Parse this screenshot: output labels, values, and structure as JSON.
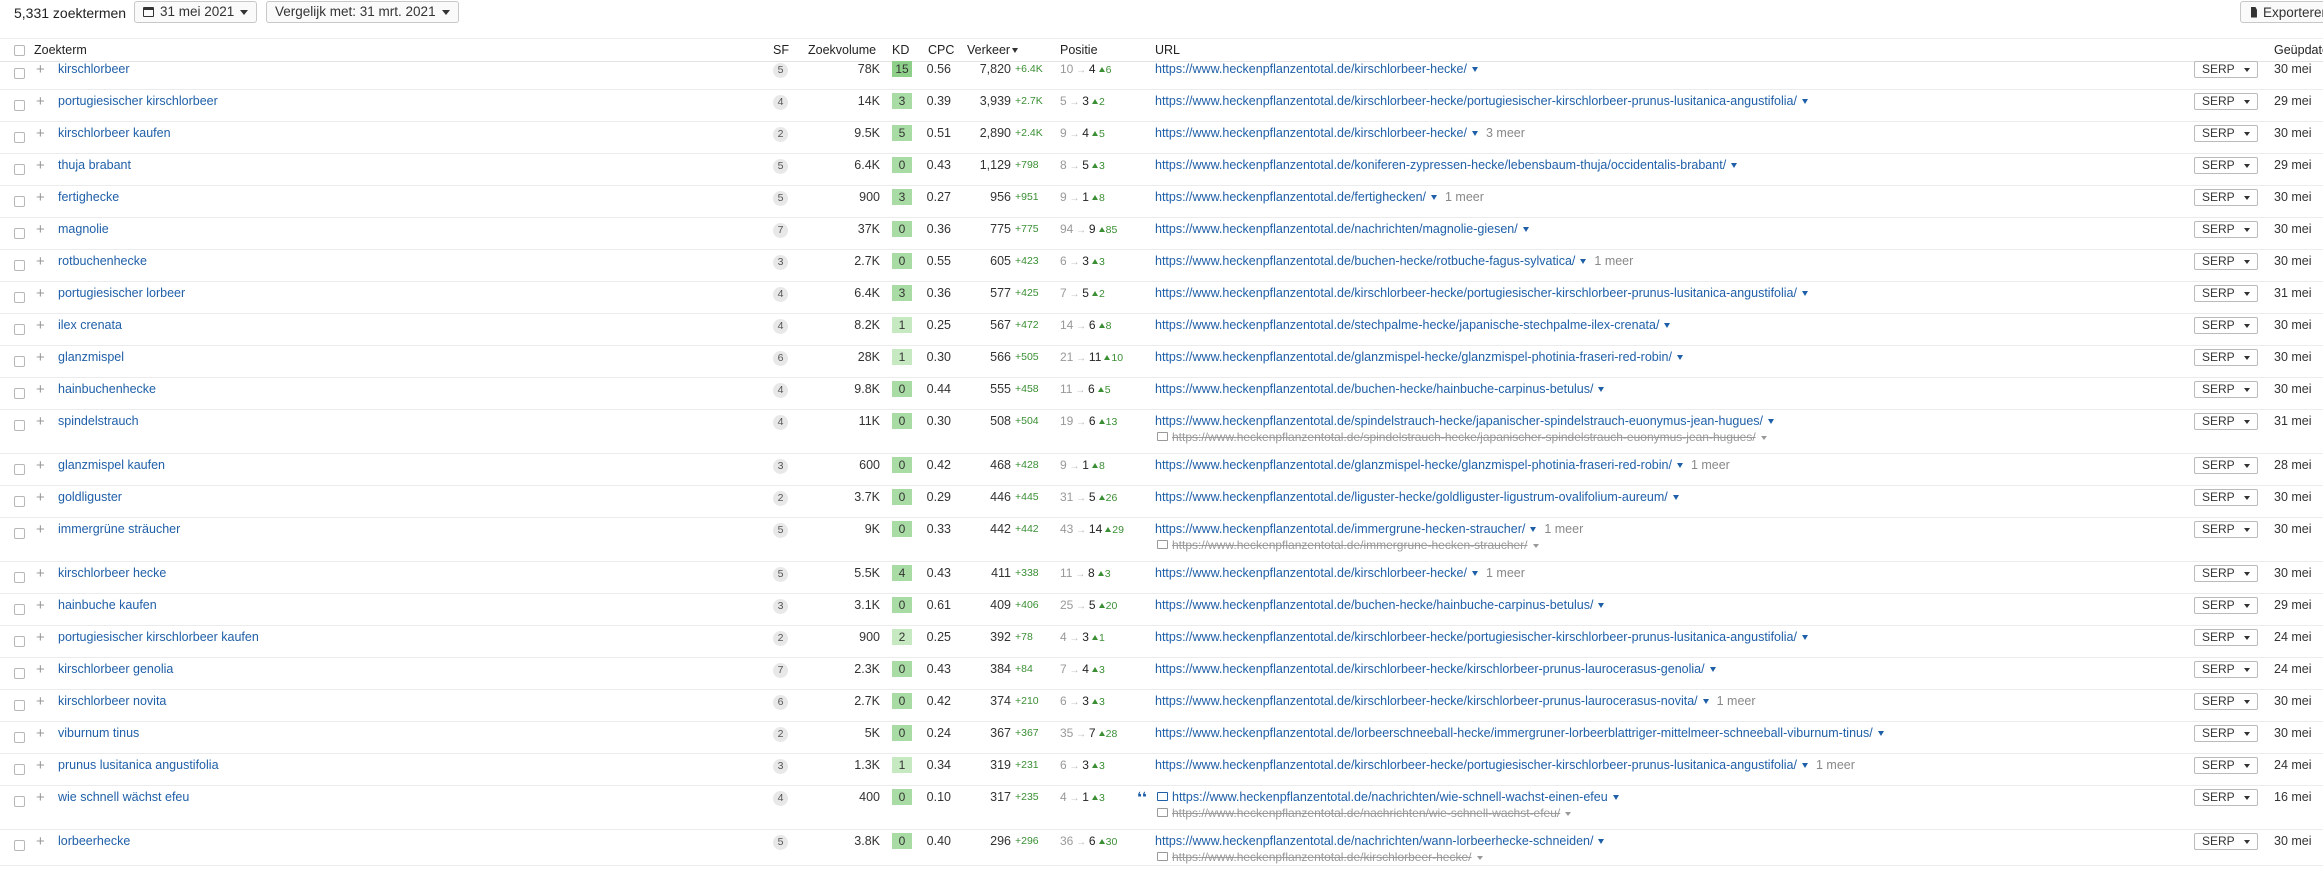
{
  "toolbar": {
    "count": "5,331 zoekterm­en",
    "date": "31 mei 2021",
    "compare": "Vergelijk met: 31 mrt. 2021",
    "export": "Exporteren"
  },
  "columns": {
    "keyword": "Zoekterm",
    "sf": "SF",
    "volume": "Zoekvolume",
    "kd": "KD",
    "cpc": "CPC",
    "traffic": "Verkeer",
    "position": "Positie",
    "url": "URL",
    "updated": "Geüpdatet"
  },
  "colors": {
    "link": "#1f5fa8",
    "positive": "#3a8f34",
    "kd_high": "#8ed08a",
    "kd_mid": "#a9dca5",
    "kd_low": "#c6e9c2"
  },
  "serp_label": "SERP",
  "rows": [
    {
      "kw": "kirschlorbeer",
      "sf": "5",
      "vol": "78K",
      "kd": "15",
      "cpc": "0.56",
      "traffic": "7,820",
      "tchg": "+6.4K",
      "from": "10",
      "to": "4",
      "delta": "6",
      "url": "https://www.heckenpflanzentotal.de/kirschlorbeer-hecke/",
      "more": "",
      "url2": "",
      "upd": "30 mei"
    },
    {
      "kw": "portugiesischer kirschlorbeer",
      "sf": "4",
      "vol": "14K",
      "kd": "3",
      "cpc": "0.39",
      "traffic": "3,939",
      "tchg": "+2.7K",
      "from": "5",
      "to": "3",
      "delta": "2",
      "url": "https://www.heckenpflanzentotal.de/kirschlorbeer-hecke/portugiesischer-kirschlorbeer-prunus-lusitanica-angustifolia/",
      "more": "",
      "url2": "",
      "upd": "29 mei"
    },
    {
      "kw": "kirschlorbeer kaufen",
      "sf": "2",
      "vol": "9.5K",
      "kd": "5",
      "cpc": "0.51",
      "traffic": "2,890",
      "tchg": "+2.4K",
      "from": "9",
      "to": "4",
      "delta": "5",
      "url": "https://www.heckenpflanzentotal.de/kirschlorbeer-hecke/",
      "more": "3 meer",
      "url2": "",
      "upd": "30 mei"
    },
    {
      "kw": "thuja brabant",
      "sf": "5",
      "vol": "6.4K",
      "kd": "0",
      "cpc": "0.43",
      "traffic": "1,129",
      "tchg": "+798",
      "from": "8",
      "to": "5",
      "delta": "3",
      "url": "https://www.heckenpflanzentotal.de/koniferen-zypressen-hecke/lebensbaum-thuja/occidentalis-brabant/",
      "more": "",
      "url2": "",
      "upd": "29 mei"
    },
    {
      "kw": "fertighecke",
      "sf": "5",
      "vol": "900",
      "kd": "3",
      "cpc": "0.27",
      "traffic": "956",
      "tchg": "+951",
      "from": "9",
      "to": "1",
      "delta": "8",
      "url": "https://www.heckenpflanzentotal.de/fertighecken/",
      "more": "1 meer",
      "url2": "",
      "upd": "30 mei"
    },
    {
      "kw": "magnolie",
      "sf": "7",
      "vol": "37K",
      "kd": "0",
      "cpc": "0.36",
      "traffic": "775",
      "tchg": "+775",
      "from": "94",
      "to": "9",
      "delta": "85",
      "url": "https://www.heckenpflanzentotal.de/nachrichten/magnolie-giesen/",
      "more": "",
      "url2": "",
      "upd": "30 mei"
    },
    {
      "kw": "rotbuchenhecke",
      "sf": "3",
      "vol": "2.7K",
      "kd": "0",
      "cpc": "0.55",
      "traffic": "605",
      "tchg": "+423",
      "from": "6",
      "to": "3",
      "delta": "3",
      "url": "https://www.heckenpflanzentotal.de/buchen-hecke/rotbuche-fagus-sylvatica/",
      "more": "1 meer",
      "url2": "",
      "upd": "30 mei"
    },
    {
      "kw": "portugiesischer lorbeer",
      "sf": "4",
      "vol": "6.4K",
      "kd": "3",
      "cpc": "0.36",
      "traffic": "577",
      "tchg": "+425",
      "from": "7",
      "to": "5",
      "delta": "2",
      "url": "https://www.heckenpflanzentotal.de/kirschlorbeer-hecke/portugiesischer-kirschlorbeer-prunus-lusitanica-angustifolia/",
      "more": "",
      "url2": "",
      "upd": "31 mei"
    },
    {
      "kw": "ilex crenata",
      "sf": "4",
      "vol": "8.2K",
      "kd": "1",
      "cpc": "0.25",
      "traffic": "567",
      "tchg": "+472",
      "from": "14",
      "to": "6",
      "delta": "8",
      "url": "https://www.heckenpflanzentotal.de/stechpalme-hecke/japanische-stechpalme-ilex-crenata/",
      "more": "",
      "url2": "",
      "upd": "30 mei"
    },
    {
      "kw": "glanzmispel",
      "sf": "6",
      "vol": "28K",
      "kd": "1",
      "cpc": "0.30",
      "traffic": "566",
      "tchg": "+505",
      "from": "21",
      "to": "11",
      "delta": "10",
      "url": "https://www.heckenpflanzentotal.de/glanzmispel-hecke/glanzmispel-photinia-fraseri-red-robin/",
      "more": "",
      "url2": "",
      "upd": "30 mei"
    },
    {
      "kw": "hainbuchenhecke",
      "sf": "4",
      "vol": "9.8K",
      "kd": "0",
      "cpc": "0.44",
      "traffic": "555",
      "tchg": "+458",
      "from": "11",
      "to": "6",
      "delta": "5",
      "url": "https://www.heckenpflanzentotal.de/buchen-hecke/hainbuche-carpinus-betulus/",
      "more": "",
      "url2": "",
      "upd": "30 mei"
    },
    {
      "kw": "spindelstrauch",
      "sf": "4",
      "vol": "11K",
      "kd": "0",
      "cpc": "0.30",
      "traffic": "508",
      "tchg": "+504",
      "from": "19",
      "to": "6",
      "delta": "13",
      "url": "https://www.heckenpflanzentotal.de/spindelstrauch-hecke/japanischer-spindelstrauch-euonymus-jean-hugues/",
      "more": "",
      "url2": "https://www.heckenpflanzentotal.de/spindelstrauch-hecke/japanischer-spindelstrauch-euonymus-jean-hugues/",
      "upd": "31 mei"
    },
    {
      "kw": "glanzmispel kaufen",
      "sf": "3",
      "vol": "600",
      "kd": "0",
      "cpc": "0.42",
      "traffic": "468",
      "tchg": "+428",
      "from": "9",
      "to": "1",
      "delta": "8",
      "url": "https://www.heckenpflanzentotal.de/glanzmispel-hecke/glanzmispel-photinia-fraseri-red-robin/",
      "more": "1 meer",
      "url2": "",
      "upd": "28 mei"
    },
    {
      "kw": "goldliguster",
      "sf": "2",
      "vol": "3.7K",
      "kd": "0",
      "cpc": "0.29",
      "traffic": "446",
      "tchg": "+445",
      "from": "31",
      "to": "5",
      "delta": "26",
      "url": "https://www.heckenpflanzentotal.de/liguster-hecke/goldliguster-ligustrum-ovalifolium-aureum/",
      "more": "",
      "url2": "",
      "upd": "30 mei"
    },
    {
      "kw": "immergrüne sträucher",
      "sf": "5",
      "vol": "9K",
      "kd": "0",
      "cpc": "0.33",
      "traffic": "442",
      "tchg": "+442",
      "from": "43",
      "to": "14",
      "delta": "29",
      "url": "https://www.heckenpflanzentotal.de/immergrune-hecken-straucher/",
      "more": "1 meer",
      "url2": "https://www.heckenpflanzentotal.de/immergrune-hecken-straucher/",
      "upd": "30 mei"
    },
    {
      "kw": "kirschlorbeer hecke",
      "sf": "5",
      "vol": "5.5K",
      "kd": "4",
      "cpc": "0.43",
      "traffic": "411",
      "tchg": "+338",
      "from": "11",
      "to": "8",
      "delta": "3",
      "url": "https://www.heckenpflanzentotal.de/kirschlorbeer-hecke/",
      "more": "1 meer",
      "url2": "",
      "upd": "30 mei"
    },
    {
      "kw": "hainbuche kaufen",
      "sf": "3",
      "vol": "3.1K",
      "kd": "0",
      "cpc": "0.61",
      "traffic": "409",
      "tchg": "+406",
      "from": "25",
      "to": "5",
      "delta": "20",
      "url": "https://www.heckenpflanzentotal.de/buchen-hecke/hainbuche-carpinus-betulus/",
      "more": "",
      "url2": "",
      "upd": "29 mei"
    },
    {
      "kw": "portugiesischer kirschlorbeer kaufen",
      "sf": "2",
      "vol": "900",
      "kd": "2",
      "cpc": "0.25",
      "traffic": "392",
      "tchg": "+78",
      "from": "4",
      "to": "3",
      "delta": "1",
      "url": "https://www.heckenpflanzentotal.de/kirschlorbeer-hecke/portugiesischer-kirschlorbeer-prunus-lusitanica-angustifolia/",
      "more": "",
      "url2": "",
      "upd": "24 mei"
    },
    {
      "kw": "kirschlorbeer genolia",
      "sf": "7",
      "vol": "2.3K",
      "kd": "0",
      "cpc": "0.43",
      "traffic": "384",
      "tchg": "+84",
      "from": "7",
      "to": "4",
      "delta": "3",
      "url": "https://www.heckenpflanzentotal.de/kirschlorbeer-hecke/kirschlorbeer-prunus-laurocerasus-genolia/",
      "more": "",
      "url2": "",
      "upd": "24 mei"
    },
    {
      "kw": "kirschlorbeer novita",
      "sf": "6",
      "vol": "2.7K",
      "kd": "0",
      "cpc": "0.42",
      "traffic": "374",
      "tchg": "+210",
      "from": "6",
      "to": "3",
      "delta": "3",
      "url": "https://www.heckenpflanzentotal.de/kirschlorbeer-hecke/kirschlorbeer-prunus-laurocerasus-novita/",
      "more": "1 meer",
      "url2": "",
      "upd": "30 mei"
    },
    {
      "kw": "viburnum tinus",
      "sf": "2",
      "vol": "5K",
      "kd": "0",
      "cpc": "0.24",
      "traffic": "367",
      "tchg": "+367",
      "from": "35",
      "to": "7",
      "delta": "28",
      "url": "https://www.heckenpflanzentotal.de/lorbeerschneeball-hecke/immergruner-lorbeerblattriger-mittelmeer-schneeball-viburnum-tinus/",
      "more": "",
      "url2": "",
      "upd": "30 mei"
    },
    {
      "kw": "prunus lusitanica angustifolia",
      "sf": "3",
      "vol": "1.3K",
      "kd": "1",
      "cpc": "0.34",
      "traffic": "319",
      "tchg": "+231",
      "from": "6",
      "to": "3",
      "delta": "3",
      "url": "https://www.heckenpflanzentotal.de/kirschlorbeer-hecke/portugiesischer-kirschlorbeer-prunus-lusitanica-angustifolia/",
      "more": "1 meer",
      "url2": "",
      "upd": "24 mei"
    },
    {
      "kw": "wie schnell wächst efeu",
      "sf": "4",
      "vol": "400",
      "kd": "0",
      "cpc": "0.10",
      "traffic": "317",
      "tchg": "+235",
      "from": "4",
      "to": "1",
      "delta": "3",
      "url": "https://www.heckenpflanzentotal.de/nachrichten/wie-schnell-wachst-einen-efeu",
      "more": "",
      "url2": "https://www.heckenpflanzentotal.de/nachrichten/wie-schnell-wachst-efeu/",
      "upd": "16 mei",
      "featured": true
    },
    {
      "kw": "lorbeerhecke",
      "sf": "5",
      "vol": "3.8K",
      "kd": "0",
      "cpc": "0.40",
      "traffic": "296",
      "tchg": "+296",
      "from": "36",
      "to": "6",
      "delta": "30",
      "url": "https://www.heckenpflanzentotal.de/nachrichten/wann-lorbeerhecke-schneiden/",
      "more": "",
      "url2": "https://www.heckenpflanzentotal.de/kirschlorbeer-hecke/",
      "upd": "30 mei"
    }
  ]
}
